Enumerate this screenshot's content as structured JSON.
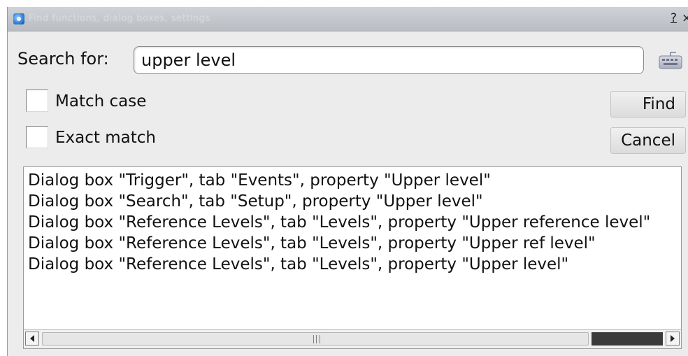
{
  "window": {
    "title": "Find functions, dialog boxes, settings",
    "help_label": "?",
    "close_label": "×"
  },
  "search": {
    "label": "Search for:",
    "value": "upper level",
    "keyboard_icon": "keyboard-icon"
  },
  "options": {
    "match_case": {
      "label": "Match case",
      "checked": false
    },
    "exact_match": {
      "label": "Exact match",
      "checked": false
    }
  },
  "buttons": {
    "find": "Find",
    "cancel": "Cancel"
  },
  "results": [
    "Dialog box \"Trigger\", tab \"Events\", property \"Upper level\"",
    "Dialog box \"Search\", tab \"Setup\", property \"Upper level\"",
    "Dialog box \"Reference Levels\", tab \"Levels\", property \"Upper reference level\"",
    "Dialog box \"Reference Levels\", tab \"Levels\", property \"Upper ref level\"",
    "Dialog box \"Reference Levels\", tab \"Levels\", property \"Upper level\""
  ],
  "colors": {
    "window_bg": "#ececec",
    "titlebar_bg": "#c4c7cb",
    "scroll_thumb_dark": "#3a3a3a"
  }
}
